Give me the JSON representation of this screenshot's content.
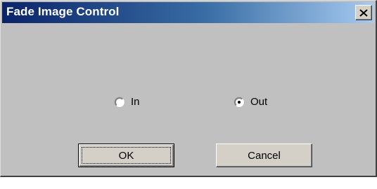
{
  "window": {
    "title": "Fade Image Control",
    "close_icon": "close-x-icon"
  },
  "radio_group": {
    "options": [
      {
        "label": "In",
        "checked": false
      },
      {
        "label": "Out",
        "checked": true
      }
    ]
  },
  "buttons": {
    "ok_label": "OK",
    "cancel_label": "Cancel"
  },
  "colors": {
    "title_gradient_start": "#0a246a",
    "title_gradient_end": "#a6caf0",
    "face": "#c0c0c0"
  }
}
